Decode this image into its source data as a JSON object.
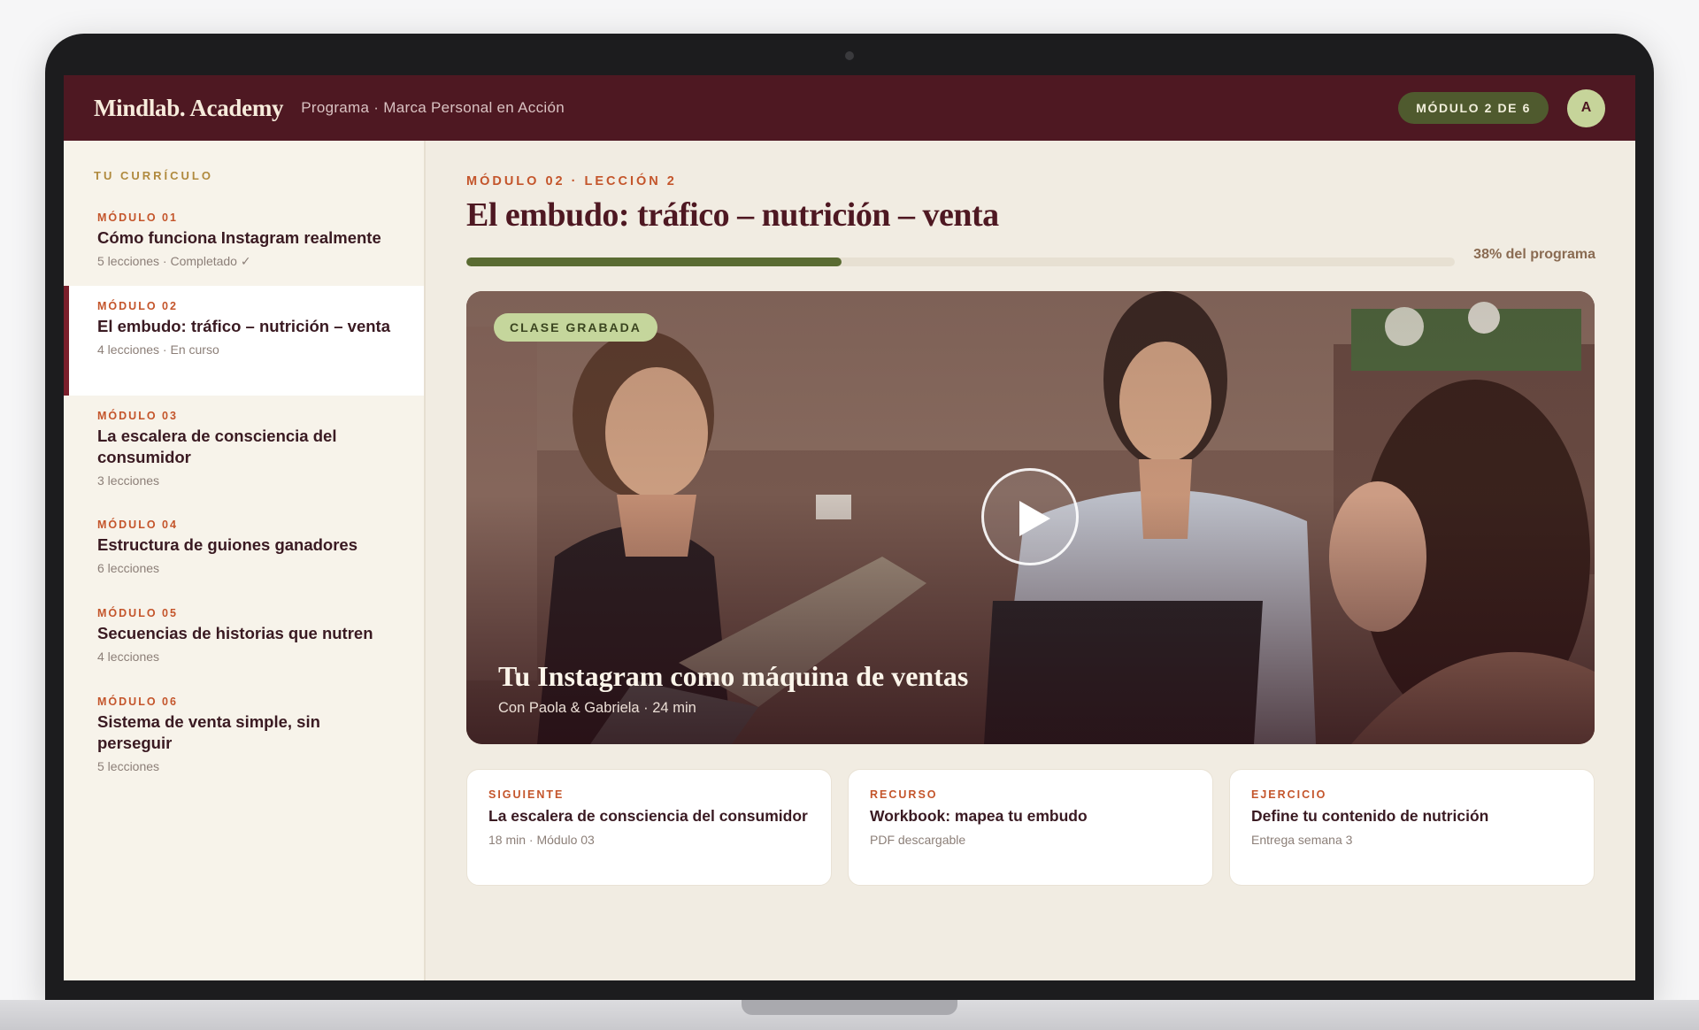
{
  "brand": {
    "logo": "Mindlab. Academy",
    "program": "Programa · Marca Personal en Acción"
  },
  "header": {
    "module_pill": "MÓDULO 2 DE 6",
    "avatar_initial": "A"
  },
  "sidebar": {
    "title": "TU CURRÍCULO",
    "items": [
      {
        "tag": "MÓDULO 01",
        "name": "Cómo funciona Instagram realmente",
        "meta": "5 lecciones · Completado ✓"
      },
      {
        "tag": "MÓDULO 02",
        "name": "El embudo: tráfico – nutrición – venta",
        "meta": "4 lecciones · En curso"
      },
      {
        "tag": "MÓDULO 03",
        "name": "La escalera de consciencia del consumidor",
        "meta": "3 lecciones"
      },
      {
        "tag": "MÓDULO 04",
        "name": "Estructura de guiones ganadores",
        "meta": "6 lecciones"
      },
      {
        "tag": "MÓDULO 05",
        "name": "Secuencias de historias que nutren",
        "meta": "4 lecciones"
      },
      {
        "tag": "MÓDULO 06",
        "name": "Sistema de venta simple, sin perseguir",
        "meta": "5 lecciones"
      }
    ]
  },
  "main": {
    "crumb": "MÓDULO 02 · LECCIÓN 2",
    "title": "El embudo: tráfico – nutrición – venta",
    "progress": {
      "fraction": 0.38,
      "label": "38% del programa"
    },
    "video": {
      "badge": "CLASE GRABADA",
      "title": "Tu Instagram como máquina de ventas",
      "subtitle": "Con Paola & Gabriela · 24 min",
      "play_icon": "play-icon"
    },
    "cards": [
      {
        "tag": "SIGUIENTE",
        "title": "La escalera de consciencia del consumidor",
        "meta": "18 min · Módulo 03"
      },
      {
        "tag": "RECURSO",
        "title": "Workbook: mapea tu embudo",
        "meta": "PDF descargable"
      },
      {
        "tag": "EJERCICIO",
        "title": "Define tu contenido de nutrición",
        "meta": "Entrega semana 3"
      }
    ]
  },
  "colors": {
    "brand": "#4e1822",
    "accent": "#c4552b",
    "progress": "#5a6b32",
    "badge": "#c5d69c"
  }
}
